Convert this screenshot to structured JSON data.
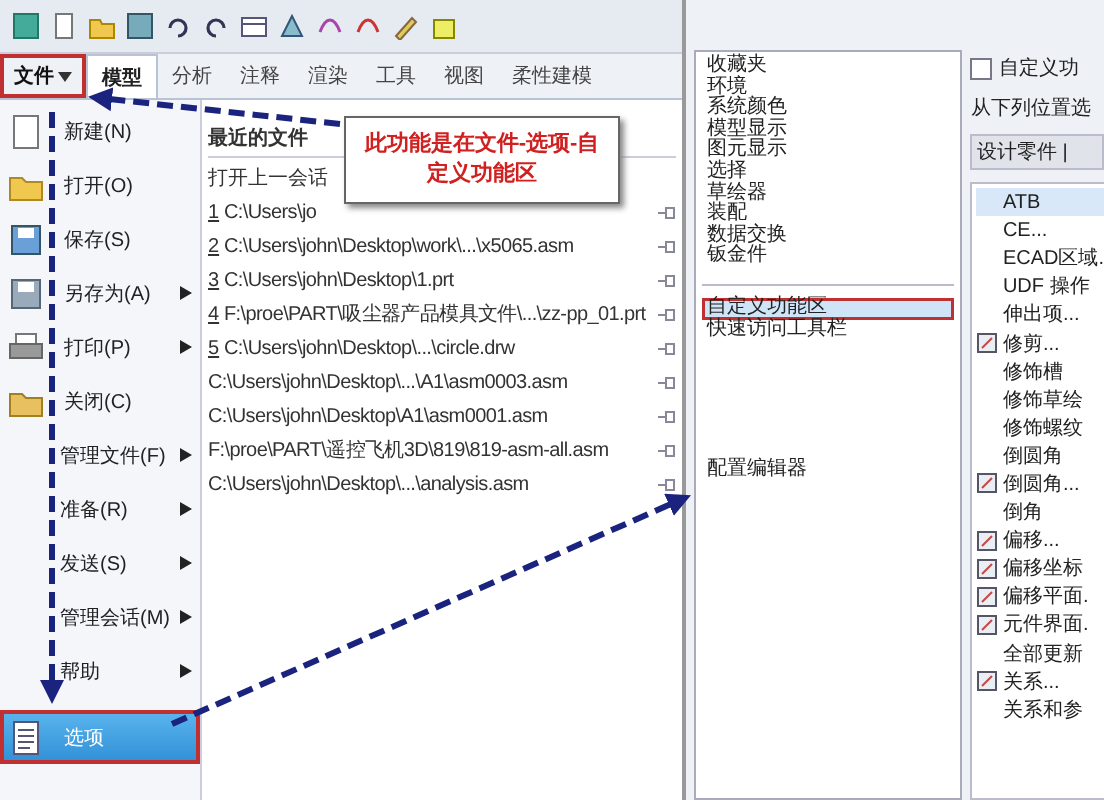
{
  "tabs": [
    {
      "label": "文件",
      "selected": false,
      "dropdown": true,
      "annotated": true
    },
    {
      "label": "模型",
      "selected": true,
      "dropdown": false,
      "annotated": false
    },
    {
      "label": "分析",
      "selected": false,
      "dropdown": false,
      "annotated": false
    },
    {
      "label": "注释",
      "selected": false,
      "dropdown": false,
      "annotated": false
    },
    {
      "label": "渲染",
      "selected": false,
      "dropdown": false,
      "annotated": false
    },
    {
      "label": "工具",
      "selected": false,
      "dropdown": false,
      "annotated": false
    },
    {
      "label": "视图",
      "selected": false,
      "dropdown": false,
      "annotated": false
    },
    {
      "label": "柔性建模",
      "selected": false,
      "dropdown": false,
      "annotated": false
    }
  ],
  "file_menu": [
    {
      "label": "新建(N)",
      "kind": "icon",
      "submenu": false,
      "selected": false,
      "annotated": false
    },
    {
      "label": "打开(O)",
      "kind": "icon",
      "submenu": false,
      "selected": false,
      "annotated": false
    },
    {
      "label": "保存(S)",
      "kind": "icon",
      "submenu": false,
      "selected": false,
      "annotated": false
    },
    {
      "label": "另存为(A)",
      "kind": "icon",
      "submenu": true,
      "selected": false,
      "annotated": false
    },
    {
      "label": "打印(P)",
      "kind": "icon",
      "submenu": true,
      "selected": false,
      "annotated": false
    },
    {
      "label": "关闭(C)",
      "kind": "icon",
      "submenu": false,
      "selected": false,
      "annotated": false
    },
    {
      "label": "管理文件(F)",
      "kind": "plain",
      "submenu": true,
      "selected": false,
      "annotated": false
    },
    {
      "label": "准备(R)",
      "kind": "plain",
      "submenu": true,
      "selected": false,
      "annotated": false
    },
    {
      "label": "发送(S)",
      "kind": "plain",
      "submenu": true,
      "selected": false,
      "annotated": false
    },
    {
      "label": "管理会话(M)",
      "kind": "plain",
      "submenu": true,
      "selected": false,
      "annotated": false
    },
    {
      "label": "帮助",
      "kind": "plain",
      "submenu": true,
      "selected": false,
      "annotated": false
    },
    {
      "label": "选项",
      "kind": "icon",
      "submenu": false,
      "selected": true,
      "annotated": true
    }
  ],
  "recent_files": {
    "title": "最近的文件",
    "open_last": "打开上一会话",
    "items": [
      {
        "number": "1",
        "path": "C:\\Users\\jo"
      },
      {
        "number": "2",
        "path": "C:\\Users\\john\\Desktop\\work\\...\\x5065.asm"
      },
      {
        "number": "3",
        "path": "C:\\Users\\john\\Desktop\\1.prt"
      },
      {
        "number": "4",
        "path": "F:\\proe\\PART\\吸尘器产品模具文件\\...\\zz-pp_01.prt"
      },
      {
        "number": "5",
        "path": "C:\\Users\\john\\Desktop\\...\\circle.drw"
      },
      {
        "path": "C:\\Users\\john\\Desktop\\...\\A1\\asm0003.asm"
      },
      {
        "path": "C:\\Users\\john\\Desktop\\A1\\asm0001.asm"
      },
      {
        "path": "F:\\proe\\PART\\遥控飞机3D\\819\\819-asm-all.asm"
      },
      {
        "path": "C:\\Users\\john\\Desktop\\...\\analysis.asm"
      }
    ]
  },
  "callout": "此功能是在文件-选项-自定义功能区",
  "options_dialog": {
    "categories": [
      {
        "label": "收藏夹",
        "selected": false,
        "annotated": false
      },
      {
        "label": "环境",
        "selected": false,
        "annotated": false
      },
      {
        "label": "系统颜色",
        "selected": false,
        "annotated": false
      },
      {
        "label": "模型显示",
        "selected": false,
        "annotated": false
      },
      {
        "label": "图元显示",
        "selected": false,
        "annotated": false
      },
      {
        "label": "选择",
        "selected": false,
        "annotated": false
      },
      {
        "label": "草绘器",
        "selected": false,
        "annotated": false
      },
      {
        "label": "装配",
        "selected": false,
        "annotated": false
      },
      {
        "label": "数据交换",
        "selected": false,
        "annotated": false
      },
      {
        "label": "钣金件",
        "selected": false,
        "annotated": false
      },
      {
        "label": "自定义功能区",
        "selected": true,
        "annotated": true
      },
      {
        "label": "快速访问工具栏",
        "selected": false,
        "annotated": false
      },
      {
        "label": "配置编辑器",
        "selected": false,
        "annotated": false
      }
    ],
    "customize_checkbox": {
      "label": "自定义功",
      "checked": false
    },
    "choose_from": "从下列位置选",
    "source": "设计零件 |",
    "commands": [
      {
        "label": "ATB",
        "icon": false,
        "selected": true
      },
      {
        "label": "CE...",
        "icon": false,
        "selected": false
      },
      {
        "label": "ECAD区域.",
        "icon": false,
        "selected": false
      },
      {
        "label": "UDF 操作",
        "icon": false,
        "selected": false
      },
      {
        "label": "伸出项...",
        "icon": false,
        "selected": false
      },
      {
        "label": "修剪...",
        "icon": true,
        "selected": false
      },
      {
        "label": "修饰槽",
        "icon": false,
        "selected": false
      },
      {
        "label": "修饰草绘",
        "icon": false,
        "selected": false
      },
      {
        "label": "修饰螺纹",
        "icon": false,
        "selected": false
      },
      {
        "label": "倒圆角",
        "icon": false,
        "selected": false
      },
      {
        "label": "倒圆角...",
        "icon": true,
        "selected": false
      },
      {
        "label": "倒角",
        "icon": false,
        "selected": false
      },
      {
        "label": "偏移...",
        "icon": true,
        "selected": false
      },
      {
        "label": "偏移坐标",
        "icon": true,
        "selected": false
      },
      {
        "label": "偏移平面.",
        "icon": true,
        "selected": false
      },
      {
        "label": "元件界面.",
        "icon": true,
        "selected": false
      },
      {
        "label": "全部更新",
        "icon": false,
        "selected": false
      },
      {
        "label": "关系...",
        "icon": true,
        "selected": false
      },
      {
        "label": "关系和参",
        "icon": false,
        "selected": false
      }
    ]
  }
}
